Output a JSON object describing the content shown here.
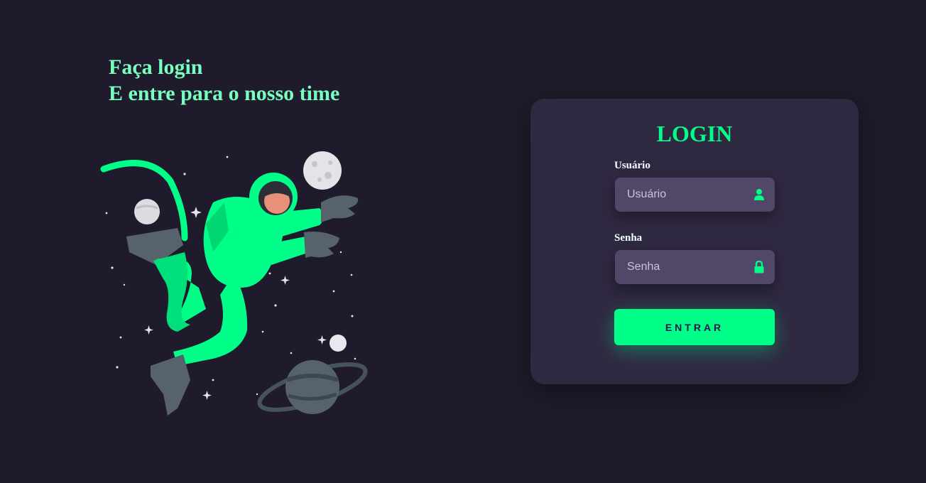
{
  "hero": {
    "line1": "Faça login",
    "line2": "E entre para o nosso time"
  },
  "illustration": {
    "name": "astronaut-illustration"
  },
  "login": {
    "title": "LOGIN",
    "username": {
      "label": "Usuário",
      "placeholder": "Usuário",
      "value": "",
      "icon": "user-icon"
    },
    "password": {
      "label": "Senha",
      "placeholder": "Senha",
      "value": "",
      "icon": "lock-icon"
    },
    "submit_label": "ENTRAR"
  },
  "colors": {
    "background": "#201b2c",
    "card": "#2f2841",
    "input": "#514869",
    "accent": "#00ff88",
    "headline": "#77ffc0"
  }
}
